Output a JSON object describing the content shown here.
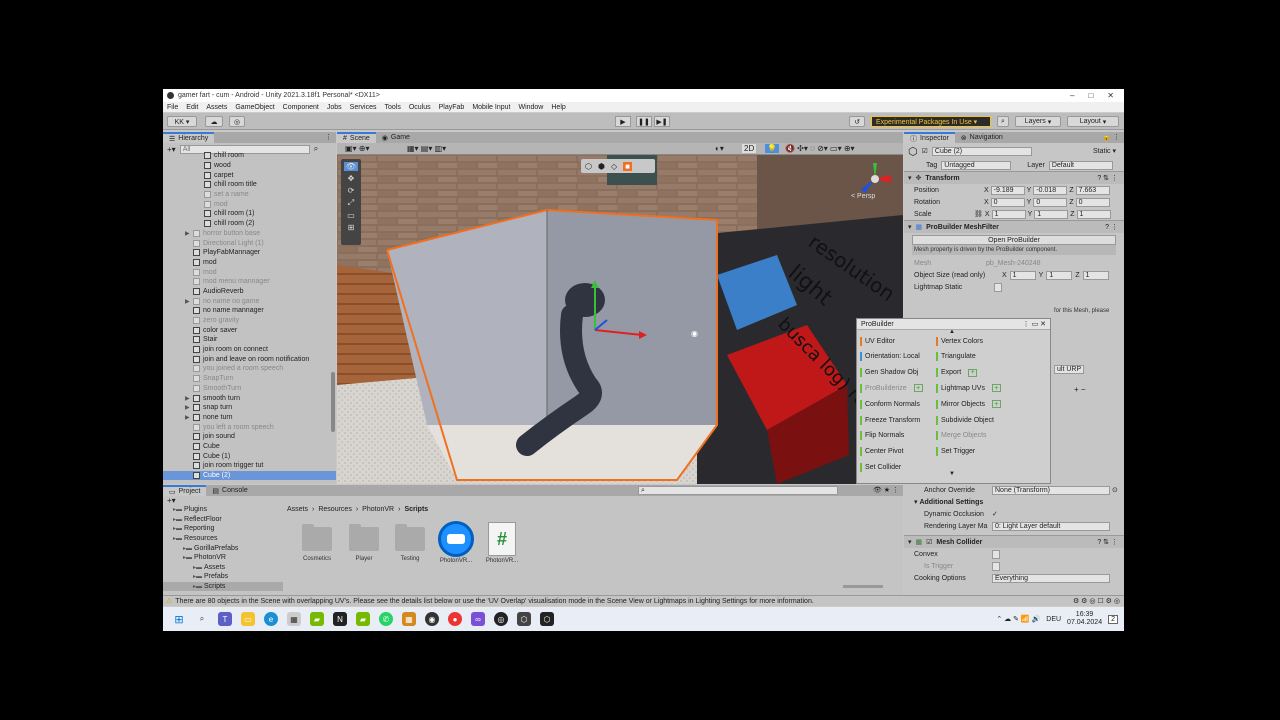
{
  "window": {
    "title": "gamer fart - cum - Android - Unity 2021.3.18f1 Personal* <DX11>",
    "controls": [
      "–",
      "□",
      "✕"
    ]
  },
  "menu": [
    "File",
    "Edit",
    "Assets",
    "GameObject",
    "Component",
    "Jobs",
    "Services",
    "Tools",
    "Oculus",
    "PlayFab",
    "Mobile Input",
    "Window",
    "Help"
  ],
  "toolbar": {
    "account": "KK ▾",
    "experimental": "Experimental Packages In Use ▾",
    "layers": "Layers",
    "layout": "Layout"
  },
  "hierarchy": {
    "tab": "Hierarchy",
    "search_placeholder": "All",
    "rows": [
      {
        "label": "chill room",
        "dim": false,
        "indent": 3
      },
      {
        "label": "wood",
        "dim": false,
        "indent": 3
      },
      {
        "label": "carpet",
        "dim": false,
        "indent": 3
      },
      {
        "label": "chill room title",
        "dim": false,
        "indent": 3
      },
      {
        "label": "set a name",
        "dim": true,
        "indent": 3
      },
      {
        "label": "mod",
        "dim": true,
        "indent": 3
      },
      {
        "label": "chill room (1)",
        "dim": false,
        "indent": 3
      },
      {
        "label": "chill room (2)",
        "dim": false,
        "indent": 3
      },
      {
        "label": "horror button base",
        "dim": true,
        "indent": 2,
        "arrow": true
      },
      {
        "label": "Directional Light (1)",
        "dim": true,
        "indent": 2
      },
      {
        "label": "PlayFabMannager",
        "dim": false,
        "indent": 2
      },
      {
        "label": "mod",
        "dim": false,
        "indent": 2
      },
      {
        "label": "mod",
        "dim": true,
        "indent": 2
      },
      {
        "label": "mod menu mannager",
        "dim": true,
        "indent": 2
      },
      {
        "label": "AudioReverb",
        "dim": false,
        "indent": 2
      },
      {
        "label": "no name no game",
        "dim": true,
        "indent": 2,
        "arrow": true
      },
      {
        "label": "no name mannager",
        "dim": false,
        "indent": 2
      },
      {
        "label": "zero gravity",
        "dim": true,
        "indent": 2
      },
      {
        "label": "color saver",
        "dim": false,
        "indent": 2
      },
      {
        "label": "Stair",
        "dim": false,
        "indent": 2
      },
      {
        "label": "join room on connect",
        "dim": false,
        "indent": 2
      },
      {
        "label": "join and leave on room notification",
        "dim": false,
        "indent": 2
      },
      {
        "label": "you joined a room speech",
        "dim": true,
        "indent": 2
      },
      {
        "label": "SnapTurn",
        "dim": true,
        "indent": 2
      },
      {
        "label": "SmoothTurn",
        "dim": true,
        "indent": 2
      },
      {
        "label": "smooth turn",
        "dim": false,
        "indent": 2,
        "arrow": true
      },
      {
        "label": "snap turn",
        "dim": false,
        "indent": 2,
        "arrow": true
      },
      {
        "label": "none turn",
        "dim": false,
        "indent": 2,
        "arrow": true
      },
      {
        "label": "you left a room speech",
        "dim": true,
        "indent": 2
      },
      {
        "label": "join sound",
        "dim": false,
        "indent": 2
      },
      {
        "label": "Cube",
        "dim": false,
        "indent": 2
      },
      {
        "label": "Cube (1)",
        "dim": false,
        "indent": 2
      },
      {
        "label": "join room trigger tut",
        "dim": false,
        "indent": 2
      },
      {
        "label": "Cube (2)",
        "dim": false,
        "indent": 2,
        "selected": true
      }
    ]
  },
  "scene": {
    "tabs": [
      "Scene",
      "Game"
    ],
    "mode_2d": "2D",
    "persp": "< Persp",
    "wall_text": "resolution\nlight\nbusca log) re"
  },
  "inspector": {
    "tabs": [
      "Inspector",
      "Navigation"
    ],
    "object_name": "Cube (2)",
    "static_label": "Static",
    "tag_label": "Tag",
    "tag_value": "Untagged",
    "layer_label": "Layer",
    "layer_value": "Default",
    "transform": {
      "title": "Transform",
      "position": {
        "label": "Position",
        "x": "-9.189",
        "y": "-0.018",
        "z": "7.663"
      },
      "rotation": {
        "label": "Rotation",
        "x": "0",
        "y": "0",
        "z": "0"
      },
      "scale": {
        "label": "Scale",
        "x": "1",
        "y": "1",
        "z": "1"
      }
    },
    "meshfilter": {
      "title": "ProBuilder MeshFilter",
      "open_btn": "Open ProBuilder",
      "note": "Mesh property is driven by the ProBuilder component.",
      "mesh_label": "Mesh",
      "mesh_value": "pb_Mesh-240248",
      "size_label": "Object Size (read only)",
      "size": {
        "x": "1",
        "y": "1",
        "z": "1"
      },
      "lightmap_label": "Lightmap Static",
      "note2": "for this Mesh, please"
    },
    "urp_value": "ult URP",
    "anchor_label": "Anchor Override",
    "anchor_value": "None (Transform)",
    "additional": "Additional Settings",
    "dyn_occlusion": "Dynamic Occlusion",
    "render_layer_label": "Rendering Layer Ma",
    "render_layer_value": "0: Light Layer default",
    "mesh_collider": "Mesh Collider",
    "convex": "Convex",
    "is_trigger": "Is Trigger",
    "cooking_label": "Cooking Options",
    "cooking_value": "Everything"
  },
  "probuilder": {
    "title": "ProBuilder",
    "left": [
      {
        "label": "UV Editor",
        "color": "#e07b2a"
      },
      {
        "label": "Orientation: Local",
        "color": "#3a8fd6"
      },
      {
        "label": "Gen Shadow Obj",
        "color": "#6cbf3a"
      },
      {
        "label": "ProBuilderize",
        "color": "#6cbf3a",
        "dim": true,
        "plus": true
      },
      {
        "label": "Conform Normals",
        "color": "#6cbf3a"
      },
      {
        "label": "Freeze Transform",
        "color": "#6cbf3a"
      },
      {
        "label": "Flip Normals",
        "color": "#6cbf3a"
      },
      {
        "label": "Center Pivot",
        "color": "#6cbf3a"
      },
      {
        "label": "Set Collider",
        "color": "#6cbf3a"
      }
    ],
    "right": [
      {
        "label": "Vertex Colors",
        "color": "#e07b2a"
      },
      {
        "label": "Triangulate",
        "color": "#6cbf3a"
      },
      {
        "label": "Export",
        "color": "#6cbf3a",
        "plus": true
      },
      {
        "label": "Lightmap UVs",
        "color": "#6cbf3a",
        "plus": true
      },
      {
        "label": "Mirror Objects",
        "color": "#6cbf3a",
        "plus": true
      },
      {
        "label": "Subdivide Object",
        "color": "#6cbf3a"
      },
      {
        "label": "Merge Objects",
        "color": "#6cbf3a",
        "dim": true
      },
      {
        "label": "Set Trigger",
        "color": "#6cbf3a"
      }
    ]
  },
  "project": {
    "tabs": [
      "Project",
      "Console"
    ],
    "tree": [
      {
        "label": "Plugins",
        "indent": 1
      },
      {
        "label": "ReflectFloor",
        "indent": 1
      },
      {
        "label": "Reporting",
        "indent": 1
      },
      {
        "label": "Resources",
        "indent": 1
      },
      {
        "label": "GorillaPrefabs",
        "indent": 2
      },
      {
        "label": "PhotonVR",
        "indent": 2
      },
      {
        "label": "Assets",
        "indent": 3
      },
      {
        "label": "Prefabs",
        "indent": 3
      },
      {
        "label": "Scripts",
        "indent": 3
      }
    ],
    "breadcrumb": [
      "Assets",
      "Resources",
      "PhotonVR",
      "Scripts"
    ],
    "items": [
      "Cosmetics",
      "Player",
      "Testing",
      "PhotonVR...",
      "PhotonVR..."
    ]
  },
  "status": {
    "warning": "There are 80 objects in the Scene with overlapping UV's. Please see the details list below or use the 'UV Overlap' visualisation mode in the Scene View or Lightmaps in Lighting Settings for more information."
  },
  "taskbar": {
    "time": "16:39",
    "date": "07.04.2024",
    "lang": "DEU",
    "notif": "2"
  },
  "colors": {
    "accent": "#3a79d7",
    "selection_outline": "#f07020",
    "warning": "#e0a000",
    "exp_text": "#f4c430"
  }
}
